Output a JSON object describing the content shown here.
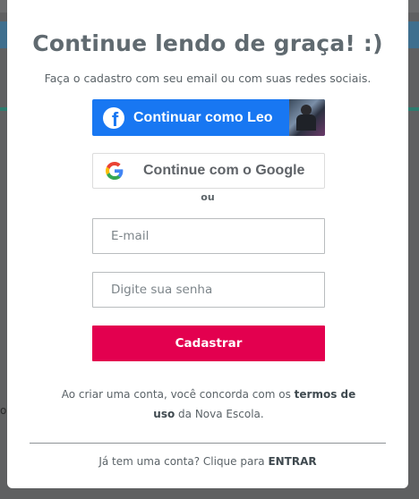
{
  "modal": {
    "title": "Continue lendo de graça! :)",
    "subtitle": "Faça o cadastro com seu email ou com suas redes sociais.",
    "facebook_button": {
      "label": "Continuar como Leo",
      "brand_color": "#1877f2"
    },
    "google_button": {
      "label": "Continue com o Google"
    },
    "separator": "ou",
    "email_field": {
      "placeholder": "E-mail",
      "value": ""
    },
    "password_field": {
      "placeholder": "Digite sua senha",
      "value": ""
    },
    "submit_button": {
      "label": "Cadastrar",
      "color": "#e3004f"
    },
    "terms": {
      "prefix": "Ao criar uma conta, você concorda com os ",
      "link": "termos de uso",
      "suffix": " da Nova Escola."
    },
    "login": {
      "prefix": "Já tem uma conta? Clique para ",
      "link": "ENTRAR"
    }
  },
  "background": {
    "edge_fragment": "o,"
  },
  "icons": {
    "facebook": "facebook-icon",
    "google": "google-icon",
    "avatar": "profile-photo"
  }
}
